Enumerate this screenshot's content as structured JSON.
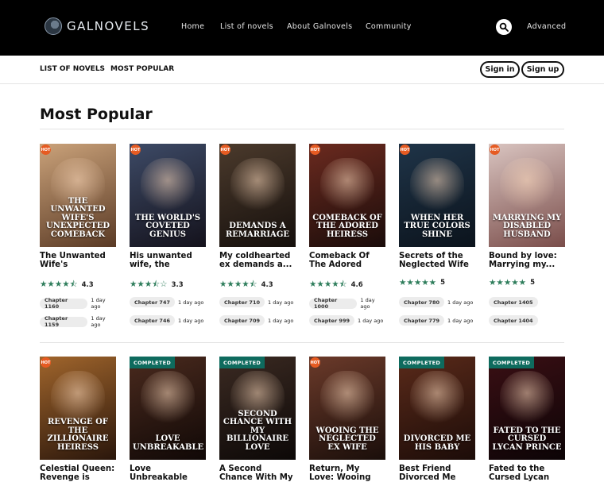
{
  "brand": "GALNOVELS",
  "nav": [
    "Home",
    "List of novels",
    "About Galnovels",
    "Community"
  ],
  "advanced": "Advanced",
  "subnav": [
    "LIST OF NOVELS",
    "MOST POPULAR"
  ],
  "auth": {
    "sign_in": "Sign in",
    "sign_up": "Sign up"
  },
  "page_title": "Most Popular",
  "badges": {
    "hot": "HOT",
    "completed": "COMPLETED"
  },
  "row1": [
    {
      "cover": "The Unwanted Wife's Unexpected Comeback",
      "title": "The Unwanted Wife's Unexpecte...",
      "rating": "4.3",
      "stars": 4.3,
      "ch1": "Chapter 1160",
      "ago1": "1 day ago",
      "ch2": "Chapter 1159",
      "ago2": "1 day ago",
      "badge": "hot",
      "colors": [
        "#caa27a",
        "#5a3a25"
      ]
    },
    {
      "cover": "The World's Coveted Genius",
      "title": "His unwanted wife, the world's...",
      "rating": "3.3",
      "stars": 3.3,
      "ch1": "Chapter 747",
      "ago1": "1 day ago",
      "ch2": "Chapter 746",
      "ago2": "1 day ago",
      "badge": "hot",
      "colors": [
        "#3d4a66",
        "#14121c"
      ]
    },
    {
      "cover": "Demands A Remarriage",
      "title": "My coldhearted ex demands a...",
      "rating": "4.3",
      "stars": 4.3,
      "ch1": "Chapter 710",
      "ago1": "1 day ago",
      "ch2": "Chapter 709",
      "ago2": "1 day ago",
      "badge": "hot",
      "colors": [
        "#4b3a2c",
        "#150f0c"
      ]
    },
    {
      "cover": "Comeback Of The Adored Heiress",
      "title": "Comeback Of The Adored Heiress",
      "rating": "4.6",
      "stars": 4.6,
      "ch1": "Chapter 1000",
      "ago1": "1 day ago",
      "ch2": "Chapter 999",
      "ago2": "1 day ago",
      "badge": "hot",
      "colors": [
        "#6b2a1f",
        "#1a0c0a"
      ]
    },
    {
      "cover": "When Her True Colors Shine",
      "title": "Secrets of the Neglected Wife",
      "rating": "5",
      "stars": 5,
      "ch1": "Chapter 780",
      "ago1": "1 day ago",
      "ch2": "Chapter 779",
      "ago2": "1 day ago",
      "badge": "hot",
      "colors": [
        "#1f3448",
        "#0b131c"
      ]
    },
    {
      "cover": "Marrying My Disabled Husband",
      "title": "Bound by love: Marrying my...",
      "rating": "5",
      "stars": 5,
      "ch1": "Chapter 1405",
      "ago1": "",
      "ch2": "Chapter 1404",
      "ago2": "",
      "badge": "hot",
      "colors": [
        "#d9c4c0",
        "#7a4d4a"
      ]
    }
  ],
  "row2": [
    {
      "cover": "Revenge of the Zillionaire Heiress",
      "title": "Celestial Queen: Revenge is Sweet",
      "badge": "hot",
      "colors": [
        "#a0652c",
        "#2a160b"
      ]
    },
    {
      "cover": "Love Unbreakable",
      "title": "Love Unbreakable",
      "badge": "completed",
      "colors": [
        "#4a2a1e",
        "#100806"
      ]
    },
    {
      "cover": "Second Chance with my Billionaire Love",
      "title": "A Second Chance With My Billionaire",
      "badge": "completed",
      "colors": [
        "#3b2a22",
        "#0c0807"
      ]
    },
    {
      "cover": "Wooing The Neglected Ex Wife",
      "title": "Return, My Love: Wooing the",
      "badge": "hot",
      "colors": [
        "#6b3a2a",
        "#1a0e0a"
      ]
    },
    {
      "cover": "Divorced Me His Baby",
      "title": "Best Friend Divorced Me Who",
      "badge": "completed",
      "colors": [
        "#5a2a1a",
        "#1c0c08"
      ]
    },
    {
      "cover": "Fated to the Cursed Lycan Prince",
      "title": "Fated to the Cursed Lycan",
      "badge": "completed",
      "colors": [
        "#3a0f14",
        "#0c0406"
      ]
    }
  ]
}
